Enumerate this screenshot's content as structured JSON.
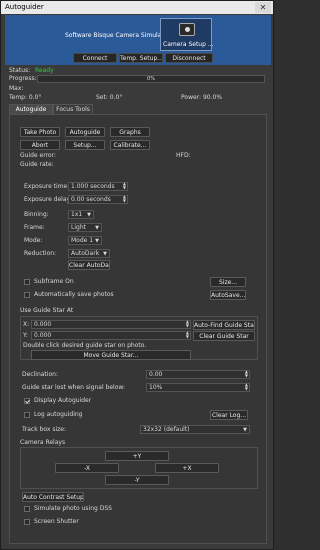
{
  "window": {
    "title": "Autoguider",
    "close_glyph": "✕"
  },
  "header": {
    "camera_name": "Software Bisque Camera Simulator",
    "camera_setup_label": "Camera Setup ...",
    "connect_label": "Connect",
    "temp_setup_label": "Temp. Setup...",
    "disconnect_label": "Disconnect"
  },
  "status": {
    "status_label": "Status:",
    "status_value": "Ready",
    "status_color": "#2ecc40",
    "progress_label": "Progress:",
    "progress_text": "0%",
    "progress_fraction": 0,
    "max_label": "Max:",
    "temp_label": "Temp: 0.0°",
    "set_label": "Set: 0.0°",
    "power_label": "Power: 90.0%"
  },
  "tabs": [
    {
      "label": "Autoguide"
    },
    {
      "label": "Focus Tools"
    }
  ],
  "actions": {
    "take_photo": "Take Photo",
    "autoguide": "Autoguide",
    "graphs": "Graphs",
    "abort": "Abort",
    "setup": "Setup...",
    "calibrate": "Calibrate..."
  },
  "info": {
    "guide_error": "Guide error:",
    "hfd": "HFD:",
    "guide_rate": "Guide rate:"
  },
  "exposure": {
    "time_label": "Exposure time:",
    "time_value": "1.000 seconds",
    "delay_label": "Exposure delay:",
    "delay_value": "0.00 seconds",
    "binning_label": "Binning:",
    "binning_value": "1x1",
    "frame_label": "Frame:",
    "frame_value": "Light",
    "mode_label": "Mode:",
    "mode_value": "Mode 1",
    "reduction_label": "Reduction:",
    "reduction_value": "AutoDark",
    "clear_autodark": "Clear AutoDark"
  },
  "subframe": {
    "subframe_on": "Subframe On",
    "size_button": "Size...",
    "auto_save": "Automatically save photos",
    "autosave_button": "AutoSave..."
  },
  "guide_star": {
    "group_title": "Use Guide Star At",
    "x_label": "X:",
    "x_value": "0.000",
    "y_label": "Y:",
    "y_value": "0.000",
    "auto_find": "Auto-Find Guide Star",
    "clear_guide": "Clear Guide Star",
    "hint": "Double click desired guide star on photo.",
    "move_button": "Move Guide Star..."
  },
  "settings": {
    "declination_label": "Declination:",
    "declination_value": "0.00",
    "lost_label": "Guide star lost when signal below:",
    "lost_value": "10%",
    "display_autoguider": "Display Autoguider",
    "log_autoguiding": "Log autoguiding",
    "clear_log": "Clear Log...",
    "track_box_label": "Track box size:",
    "track_box_value": "32x32 (default)"
  },
  "relays": {
    "group_title": "Camera Relays",
    "plus_y": "+Y",
    "minus_x": "-X",
    "plus_x": "+X",
    "minus_y": "-Y"
  },
  "bottom": {
    "auto_contrast": "Auto Contrast Setup...",
    "simulate_dss": "Simulate photo using DSS",
    "screen_shutter": "Screen Shutter"
  }
}
